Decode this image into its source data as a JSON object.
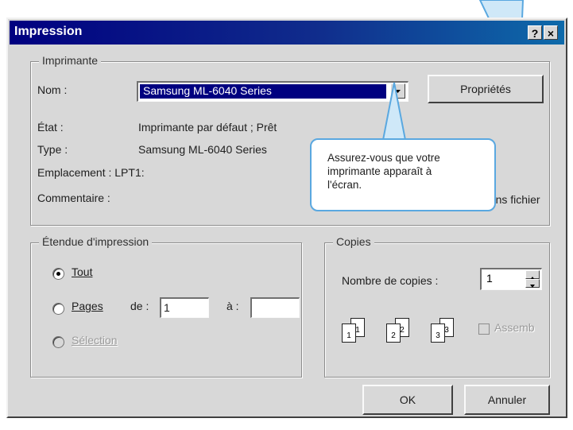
{
  "window": {
    "title": "Impression",
    "help_button": "?",
    "close_button": "×"
  },
  "printer_group": {
    "legend": "Imprimante",
    "name_label": "Nom :",
    "name_value": "Samsung ML-6040 Series",
    "properties_button": "Propriétés",
    "status_label": "État :",
    "status_value": "Imprimante par défaut ; Prêt",
    "type_label": "Type :",
    "type_value": "Samsung ML-6040 Series",
    "location_label": "Emplacement : LPT1:",
    "comment_label": "Commentaire :",
    "print_to_file_label": "dans fichier"
  },
  "range_group": {
    "legend": "Étendue d'impression",
    "all_label": "Tout",
    "all_selected": true,
    "pages_label": "Pages",
    "from_label": "de :",
    "from_value": "1",
    "to_label": "à :",
    "to_value": "",
    "selection_label": "Sélection"
  },
  "copies_group": {
    "legend": "Copies",
    "count_label": "Nombre de copies :",
    "count_value": "1",
    "collate_label": "Assemb",
    "collate_checked": false,
    "collate_pages": [
      "1",
      "1",
      "2",
      "2",
      "3",
      "3"
    ]
  },
  "buttons": {
    "ok": "OK",
    "cancel": "Annuler"
  },
  "callout": {
    "lines": [
      "Assurez-vous que votre",
      "imprimante apparaît à",
      "l'écran."
    ]
  },
  "colors": {
    "accent_callout": "#5aa8e0",
    "titlebar": "#000080",
    "selection_highlight": "#000080"
  }
}
